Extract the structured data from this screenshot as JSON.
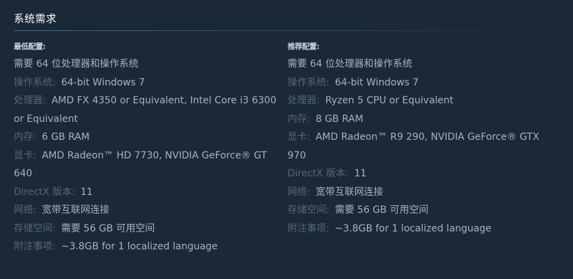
{
  "header": {
    "title": "系统需求"
  },
  "minimum": {
    "title": "最低配置:",
    "note": "需要 64 位处理器和操作系统",
    "rows": [
      {
        "label": "操作系统:",
        "value": "64-bit Windows 7"
      },
      {
        "label": "处理器:",
        "value": "AMD FX 4350 or Equivalent, Intel Core i3 6300 or Equivalent"
      },
      {
        "label": "内存:",
        "value": "6 GB RAM"
      },
      {
        "label": "显卡:",
        "value": "AMD Radeon™ HD 7730, NVIDIA GeForce® GT 640"
      },
      {
        "label": "DirectX 版本:",
        "value": "11"
      },
      {
        "label": "网络:",
        "value": "宽带互联网连接"
      },
      {
        "label": "存储空间:",
        "value": "需要 56 GB 可用空间"
      },
      {
        "label": "附注事项:",
        "value": "~3.8GB for 1 localized language"
      }
    ]
  },
  "recommended": {
    "title": "推荐配置:",
    "note": "需要 64 位处理器和操作系统",
    "rows": [
      {
        "label": "操作系统:",
        "value": "64-bit Windows 7"
      },
      {
        "label": "处理器:",
        "value": "Ryzen 5 CPU or Equivalent"
      },
      {
        "label": "内存:",
        "value": "8 GB RAM"
      },
      {
        "label": "显卡:",
        "value": "AMD Radeon™ R9 290, NVIDIA GeForce® GTX 970"
      },
      {
        "label": "DirectX 版本:",
        "value": "11"
      },
      {
        "label": "网络:",
        "value": "宽带互联网连接"
      },
      {
        "label": "存储空间:",
        "value": "需要 56 GB 可用空间"
      },
      {
        "label": "附注事项:",
        "value": "~3.8GB for 1 localized language"
      }
    ]
  }
}
